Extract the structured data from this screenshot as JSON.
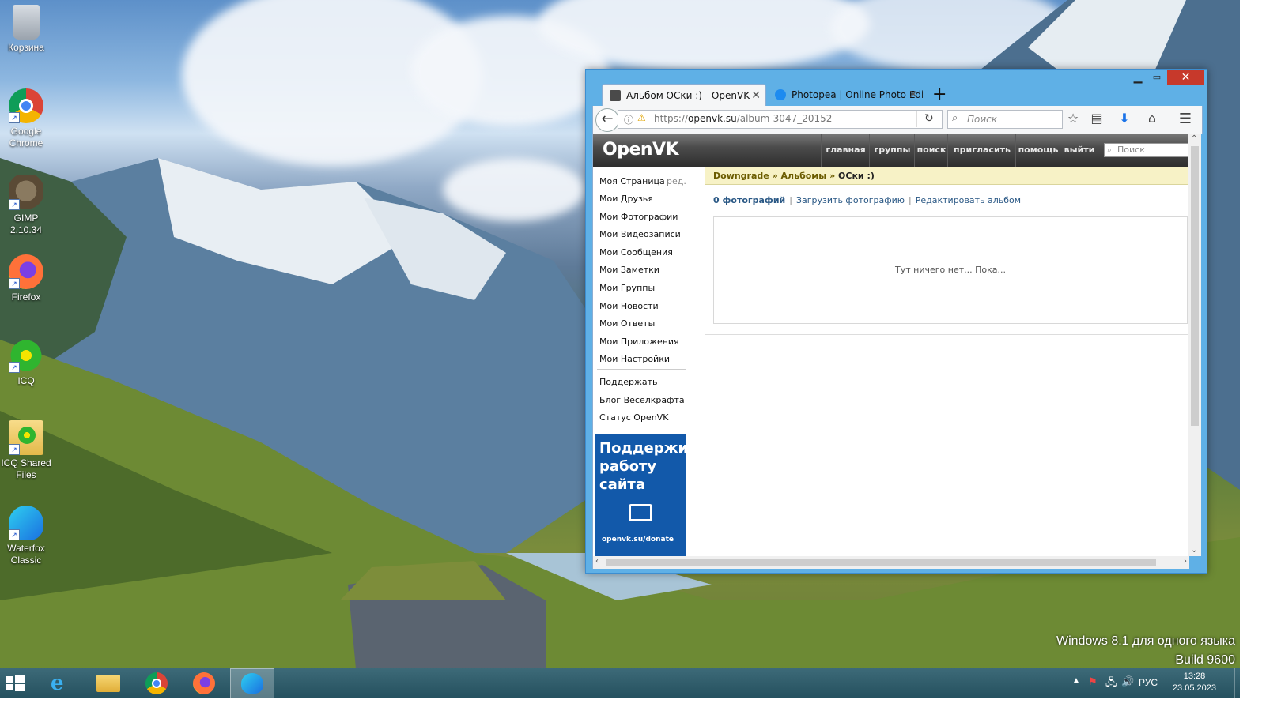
{
  "desktop": {
    "icons": [
      {
        "label": "Корзина",
        "icon": "recycle-bin-icon"
      },
      {
        "label": "Google Chrome",
        "icon": "chrome-icon"
      },
      {
        "label": "GIMP 2.10.34",
        "icon": "gimp-icon"
      },
      {
        "label": "Firefox",
        "icon": "firefox-icon"
      },
      {
        "label": "ICQ",
        "icon": "icq-icon"
      },
      {
        "label": "ICQ Shared Files",
        "icon": "icq-shared-files-icon"
      },
      {
        "label": "Waterfox Classic",
        "icon": "waterfox-icon"
      }
    ],
    "watermark_line1": "Windows 8.1 для одного языка",
    "watermark_line2": "Build 9600"
  },
  "browser": {
    "tabs": [
      {
        "title": "Альбом ОСки :) - OpenVK",
        "active": true
      },
      {
        "title": "Photopea | Online Photo Edi",
        "active": false
      }
    ],
    "url_prefix": "https://",
    "url_domain": "openvk.su",
    "url_path": "/album-3047_20152",
    "search_placeholder": "Поиск"
  },
  "site": {
    "logo": "OpenVK",
    "nav": [
      "главная",
      "группы",
      "поиск",
      "пригласить",
      "помощь",
      "выйти"
    ],
    "search_placeholder": "Поиск",
    "sidebar": {
      "items": [
        "Моя Страница",
        "Мои Друзья",
        "Мои Фотографии",
        "Мои Видеозаписи",
        "Мои Сообщения",
        "Мои Заметки",
        "Мои Группы",
        "Мои Новости",
        "Мои Ответы",
        "Мои Приложения",
        "Мои Настройки"
      ],
      "edit": "ред.",
      "extra": [
        "Поддержать",
        "Блог Веселкрафта",
        "Статус OpenVK"
      ],
      "promo_text": "Поддержи работу сайта",
      "promo_url": "openvk.su/donate"
    },
    "breadcrumb": {
      "group": "Downgrade",
      "sep": "»",
      "albums": "Альбомы",
      "current": "ОСки :)"
    },
    "photo_count": "0 фотографий",
    "upload": "Загрузить фотографию",
    "edit_album": "Редактировать альбом",
    "empty": "Тут ничего нет... Пока..."
  },
  "taskbar": {
    "apps": [
      "start-icon",
      "internet-explorer-icon",
      "file-explorer-icon",
      "chrome-icon",
      "firefox-icon",
      "waterfox-icon"
    ],
    "language": "РУС",
    "time": "13:28",
    "date": "23.05.2023"
  },
  "colors": {
    "accent_link": "#2a5885",
    "breadcrumb_bg": "#f7f2c6",
    "promo_bg": "#1259aa",
    "window_frame": "#5fb0e6"
  }
}
